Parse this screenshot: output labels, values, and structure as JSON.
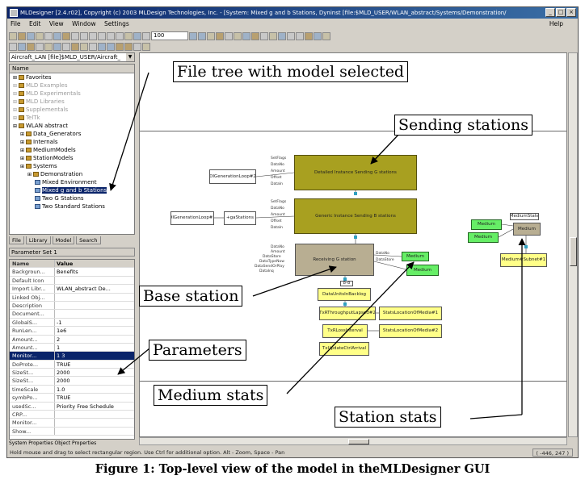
{
  "window": {
    "title": "MLDesigner [2.4.r02], Copyright (c) 2003 MLDesign Technologies, Inc. - [System: Mixed g and b Stations, Dyninst [file:$MLD_USER/WLAN_abstract/Systems/Demonstration/"
  },
  "menu": {
    "items": [
      "File",
      "Edit",
      "View",
      "Window",
      "Settings"
    ],
    "help": "Help"
  },
  "toolbar": {
    "zoom": "100"
  },
  "library": {
    "combo": "Aircraft_LAN [file]$MLD_USER/Aircraft_",
    "column": "Name",
    "tree": [
      {
        "label": "Favorites",
        "depth": 0,
        "style": "normal"
      },
      {
        "label": "MLD Examples",
        "depth": 0,
        "style": "dim"
      },
      {
        "label": "MLD Experimentals",
        "depth": 0,
        "style": "dim"
      },
      {
        "label": "MLD Libraries",
        "depth": 0,
        "style": "dim"
      },
      {
        "label": "Supplementals",
        "depth": 0,
        "style": "dim"
      },
      {
        "label": "TelTk",
        "depth": 0,
        "style": "dim"
      },
      {
        "label": "WLAN abstract",
        "depth": 0,
        "style": "normal"
      },
      {
        "label": "Data_Generators",
        "depth": 1,
        "style": "normal"
      },
      {
        "label": "Internals",
        "depth": 1,
        "style": "normal"
      },
      {
        "label": "MediumModels",
        "depth": 1,
        "style": "normal"
      },
      {
        "label": "StationModels",
        "depth": 1,
        "style": "normal"
      },
      {
        "label": "Systems",
        "depth": 1,
        "style": "normal"
      },
      {
        "label": "Demonstration",
        "depth": 2,
        "style": "normal"
      },
      {
        "label": "Mixed Environment",
        "depth": 3,
        "style": "normal"
      },
      {
        "label": "Mixed g and b Stations",
        "depth": 3,
        "style": "selected"
      },
      {
        "label": "Two G Stations",
        "depth": 3,
        "style": "normal"
      },
      {
        "label": "Two Standard Stations",
        "depth": 3,
        "style": "normal"
      }
    ],
    "tabs": [
      "File",
      "Library",
      "Model",
      "Search"
    ]
  },
  "parameters": {
    "header": "Parameter Set 1",
    "columns": [
      "Name",
      "Value"
    ],
    "rows": [
      {
        "name": "Backgroun...",
        "value": "Benefits",
        "sel": false
      },
      {
        "name": "Default Icon",
        "value": "",
        "sel": false
      },
      {
        "name": "Import Libr...",
        "value": "WLAN_abstract De...",
        "sel": false
      },
      {
        "name": "Linked Obj...",
        "value": "",
        "sel": false
      },
      {
        "name": "Description",
        "value": "",
        "sel": false
      },
      {
        "name": "Document...",
        "value": "",
        "sel": false
      },
      {
        "name": "GlobalS...",
        "value": "-1",
        "sel": false
      },
      {
        "name": "RunLen...",
        "value": "1e6",
        "sel": false
      },
      {
        "name": "Amount...",
        "value": "2",
        "sel": false
      },
      {
        "name": "Amount...",
        "value": "1",
        "sel": false
      },
      {
        "name": "Monitor...",
        "value": "1 3",
        "sel": true
      },
      {
        "name": "DoProte...",
        "value": "TRUE",
        "sel": false
      },
      {
        "name": "SizeSt...",
        "value": "2000",
        "sel": false
      },
      {
        "name": "SizeSt...",
        "value": "2000",
        "sel": false
      },
      {
        "name": "timeScale",
        "value": "1.0",
        "sel": false
      },
      {
        "name": "symbPo...",
        "value": "TRUE",
        "sel": false
      },
      {
        "name": "usedSc...",
        "value": "Priority Free Schedule",
        "sel": false
      },
      {
        "name": "CRP...",
        "value": "",
        "sel": false
      },
      {
        "name": "Monitor...",
        "value": "",
        "sel": false
      },
      {
        "name": "Show...",
        "value": "",
        "sel": false
      }
    ],
    "tabs": "System Properties  Object Properties"
  },
  "canvas": {
    "blocks": [
      {
        "id": "sendG",
        "label": "Detailed Instance Sending G stations",
        "cls": "olive"
      },
      {
        "id": "sendB",
        "label": "Generic Instance Sending B stations",
        "cls": "olive"
      },
      {
        "id": "recvG",
        "label": "Receiving G station",
        "cls": "tan"
      },
      {
        "id": "gen1",
        "label": "DIGenerationLoop#2",
        "cls": "gen"
      },
      {
        "id": "gen2",
        "label": "DIGenerationLoop#1",
        "cls": "gen"
      },
      {
        "id": "gen3",
        "label": "+gaStations",
        "cls": "gen"
      },
      {
        "id": "med1",
        "label": "Medium",
        "cls": "grn"
      },
      {
        "id": "med2",
        "label": "Medium",
        "cls": "grn"
      },
      {
        "id": "med3",
        "label": "Medium",
        "cls": "grn"
      },
      {
        "id": "med4",
        "label": "Medium",
        "cls": "grn"
      },
      {
        "id": "mediumbox",
        "label": "Medium",
        "cls": "tan"
      },
      {
        "id": "mediumstate",
        "label": "MediumState",
        "cls": "gen"
      },
      {
        "id": "y1",
        "label": "DataUnitsInBacklog",
        "cls": "yel"
      },
      {
        "id": "y2",
        "label": "TxRThroughputLapsed#2",
        "cls": "yel"
      },
      {
        "id": "y3",
        "label": "TxRLossInterval",
        "cls": "yel"
      },
      {
        "id": "y4",
        "label": "TxUpdateCtrlArrival",
        "cls": "yel"
      },
      {
        "id": "y5",
        "label": "StatsLocationOfMedia#1",
        "cls": "yel"
      },
      {
        "id": "y6",
        "label": "StatsLocationOfMedia#2",
        "cls": "yel"
      },
      {
        "id": "y7",
        "label": "Medium#Subnet#1",
        "cls": "yel"
      },
      {
        "id": "badge",
        "label": "8-8",
        "cls": "gen"
      }
    ],
    "ports_sendG": [
      "SetFlags",
      "DataNo",
      "Amount",
      "Offset",
      "DataIn"
    ],
    "ports_sendB": [
      "SetFlags",
      "DataNo",
      "Amount",
      "Offset",
      "DataIn"
    ],
    "ports_recvG": [
      "DataNo",
      "Amount",
      "DataStore",
      "DataTypeNow",
      "DataSendOrPlay",
      "DataInq"
    ],
    "ports_recvG_out": [
      "DataNo",
      "DataStore"
    ]
  },
  "callouts": {
    "filetree": "File tree with  model selected",
    "sending": "Sending stations",
    "base": "Base station",
    "params": "Parameters",
    "medium": "Medium stats",
    "station": "Station stats"
  },
  "statusbar": {
    "text": "Hold mouse and drag to select rectangular region. Use Ctrl for additional option.  Alt - Zoom, Space - Pan",
    "coords": "( -446, 247 )"
  },
  "caption": "Figure 1: Top-level view of the model in theMLDesigner GUI"
}
